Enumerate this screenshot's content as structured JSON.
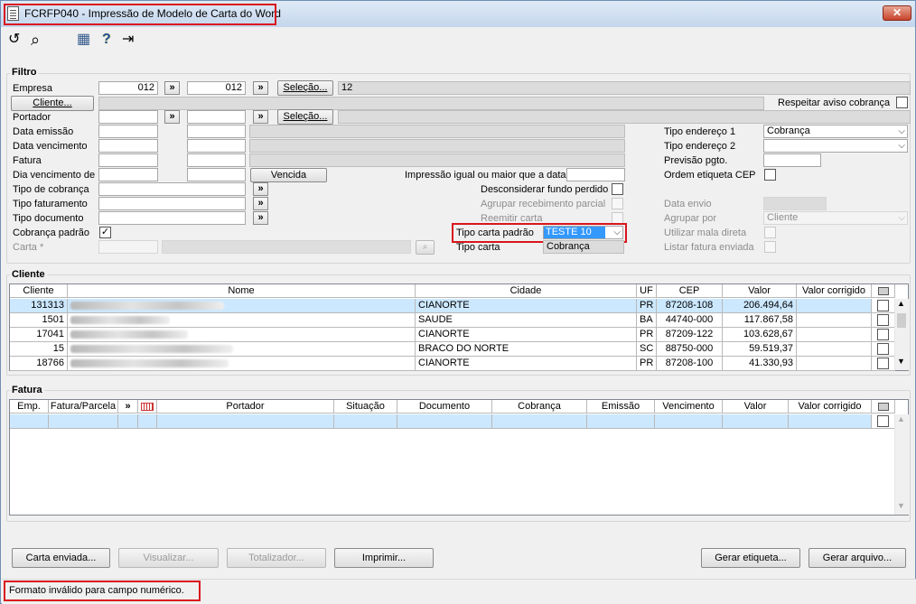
{
  "window": {
    "title": "FCRFP040 - Impressão de Modelo de Carta do Word",
    "close_glyph": "✕"
  },
  "toolbar": {
    "undo_glyph": "↺",
    "search_glyph": "⌕",
    "calculator_glyph": "▦",
    "help_glyph": "?",
    "exit_glyph": "⇥"
  },
  "filtro": {
    "group_label": "Filtro",
    "empresa_label": "Empresa",
    "empresa_from": "012",
    "empresa_to": "012",
    "empresa_selecao": "Seleção...",
    "empresa_selected": "12",
    "cliente_button": "Cliente...",
    "respeitar_label": "Respeitar aviso cobrança",
    "portador_label": "Portador",
    "portador_selecao": "Seleção...",
    "data_emissao_label": "Data emissão",
    "data_vencimento_label": "Data vencimento",
    "fatura_label": "Fatura",
    "dia_vencimento_label": "Dia vencimento de",
    "vencida_button": "Vencida",
    "impressao_label": "Impressão igual ou maior que a data",
    "tipo_cobranca_label": "Tipo de cobrança",
    "tipo_faturamento_label": "Tipo faturamento",
    "tipo_documento_label": "Tipo documento",
    "cobranca_padrao_label": "Cobrança padrão",
    "cobranca_padrao_checked": "✓",
    "carta_label": "Carta *",
    "desconsiderar_label": "Desconsiderar fundo perdido",
    "agrupar_recebimento_label": "Agrupar recebimento parcial",
    "reemitir_label": "Reemitir carta",
    "tipo_carta_padrao_label": "Tipo carta padrão",
    "tipo_carta_padrao_value": "TESTE 10",
    "tipo_carta_label": "Tipo carta",
    "tipo_carta_value": "Cobrança",
    "tipo_endereco1_label": "Tipo endereço 1",
    "tipo_endereco1_value": "Cobrança",
    "tipo_endereco2_label": "Tipo endereço 2",
    "previsao_label": "Previsão pgto.",
    "ordem_etiqueta_label": "Ordem etiqueta CEP",
    "data_envio_label": "Data envio",
    "agrupar_por_label": "Agrupar por",
    "agrupar_por_value": "Cliente",
    "utilizar_mala_label": "Utilizar mala direta",
    "listar_fatura_label": "Listar fatura enviada",
    "chevron_glyph": "»",
    "dropdown_glyph": "⌵"
  },
  "cliente": {
    "group_label": "Cliente",
    "columns": [
      "Cliente",
      "Nome",
      "Cidade",
      "UF",
      "CEP",
      "Valor",
      "Valor corrigido"
    ],
    "rows": [
      {
        "cliente": "131313",
        "cidade": "CIANORTE",
        "uf": "PR",
        "cep": "87208-108",
        "valor": "206.494,64",
        "valor_corrigido": ""
      },
      {
        "cliente": "1501",
        "cidade": "SAUDE",
        "uf": "BA",
        "cep": "44740-000",
        "valor": "117.867,58",
        "valor_corrigido": ""
      },
      {
        "cliente": "17041",
        "cidade": "CIANORTE",
        "uf": "PR",
        "cep": "87209-122",
        "valor": "103.628,67",
        "valor_corrigido": ""
      },
      {
        "cliente": "15",
        "cidade": "BRACO DO NORTE",
        "uf": "SC",
        "cep": "88750-000",
        "valor": "59.519,37",
        "valor_corrigido": ""
      },
      {
        "cliente": "18766",
        "cidade": "CIANORTE",
        "uf": "PR",
        "cep": "87208-100",
        "valor": "41.330,93",
        "valor_corrigido": ""
      }
    ]
  },
  "fatura": {
    "group_label": "Fatura",
    "columns": [
      "Emp.",
      "Fatura/Parcela",
      "»",
      "",
      "Portador",
      "Situação",
      "Documento",
      "Cobrança",
      "Emissão",
      "Vencimento",
      "Valor",
      "Valor corrigido"
    ]
  },
  "buttons": {
    "carta_enviada": "Carta enviada...",
    "visualizar": "Visualizar...",
    "totalizador": "Totalizador...",
    "imprimir": "Imprimir...",
    "gerar_etiqueta": "Gerar etiqueta...",
    "gerar_arquivo": "Gerar arquivo..."
  },
  "status": {
    "message": "Formato inválido para campo numérico."
  }
}
